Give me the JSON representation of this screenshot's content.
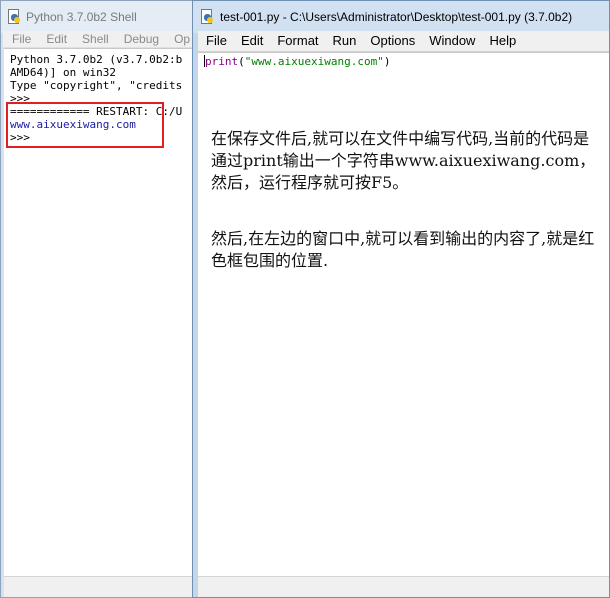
{
  "shell": {
    "title": "Python 3.7.0b2 Shell",
    "menu": [
      "File",
      "Edit",
      "Shell",
      "Debug",
      "Op"
    ],
    "lines": {
      "l1": "Python 3.7.0b2 (v3.7.0b2:b",
      "l2": "AMD64)] on win32",
      "l3": "Type \"copyright\", \"credits",
      "l4": ">>>",
      "restart": "============ RESTART: C:/U",
      "output": "www.aixuexiwang.com",
      "prompt": ">>>"
    }
  },
  "editor": {
    "title": "test-001.py - C:\\Users\\Administrator\\Desktop\\test-001.py (3.7.0b2)",
    "menu": [
      "File",
      "Edit",
      "Format",
      "Run",
      "Options",
      "Window",
      "Help"
    ],
    "code": {
      "func": "print",
      "open": "(",
      "string": "\"www.aixuexiwang.com\"",
      "close": ")"
    },
    "note1": "在保存文件后,就可以在文件中编写代码,当前的代码是通过print输出一个字符串www.aixuexiwang.com，然后，运行程序就可按F5。",
    "note2": "然后,在左边的窗口中,就可以看到输出的内容了,就是红色框包围的位置."
  },
  "colors": {
    "keyword": "#8b008b",
    "string": "#008000",
    "output": "#1a1aa6",
    "highlight_box": "#e02020"
  },
  "icons": {
    "window_icon": "python-file-icon"
  }
}
